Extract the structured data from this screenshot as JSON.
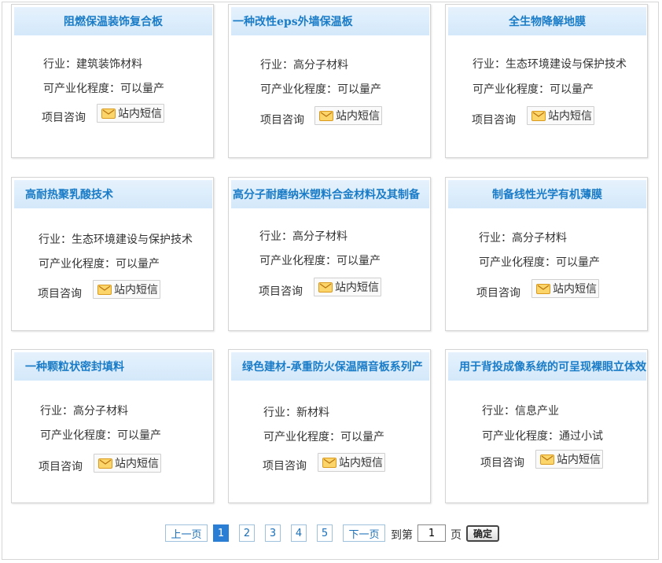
{
  "labels": {
    "industry_prefix": "行业：",
    "industrialization_prefix": "可产业化程度：",
    "consult": "项目咨询",
    "message_button": "站内短信"
  },
  "cards": [
    {
      "title": "阻燃保温装饰复合板",
      "industry": "建筑装饰材料",
      "industrialization": "可以量产"
    },
    {
      "title": "一种改性eps外墙保温板",
      "industry": "高分子材料",
      "industrialization": "可以量产"
    },
    {
      "title": "全生物降解地膜",
      "industry": "生态环境建设与保护技术",
      "industrialization": "可以量产"
    },
    {
      "title": "高耐热聚乳酸技术",
      "industry": "生态环境建设与保护技术",
      "industrialization": "可以量产"
    },
    {
      "title": "高分子耐磨纳米塑料合金材料及其制备",
      "industry": "高分子材料",
      "industrialization": "可以量产"
    },
    {
      "title": "制备线性光学有机薄膜",
      "industry": "高分子材料",
      "industrialization": "可以量产"
    },
    {
      "title": "一种颗粒状密封填料",
      "industry": "高分子材料",
      "industrialization": "可以量产"
    },
    {
      "title": "绿色建材-承重防火保温隔音板系列产",
      "industry": "新材料",
      "industrialization": "可以量产"
    },
    {
      "title": "用于背投成像系统的可呈现裸眼立体效",
      "industry": "信息产业",
      "industrialization": "通过小试"
    }
  ],
  "pagination": {
    "prev": "上一页",
    "pages": [
      "1",
      "2",
      "3",
      "4",
      "5"
    ],
    "current_page": "1",
    "next": "下一页",
    "goto_prefix": "到第",
    "goto_value": "1",
    "goto_suffix": "页",
    "confirm": "确定"
  },
  "icons": {
    "message": "envelope-icon"
  },
  "colors": {
    "title_text": "#1a7cc7",
    "title_bg": "#d9ebfb",
    "active_page": "#2a7ed3"
  }
}
